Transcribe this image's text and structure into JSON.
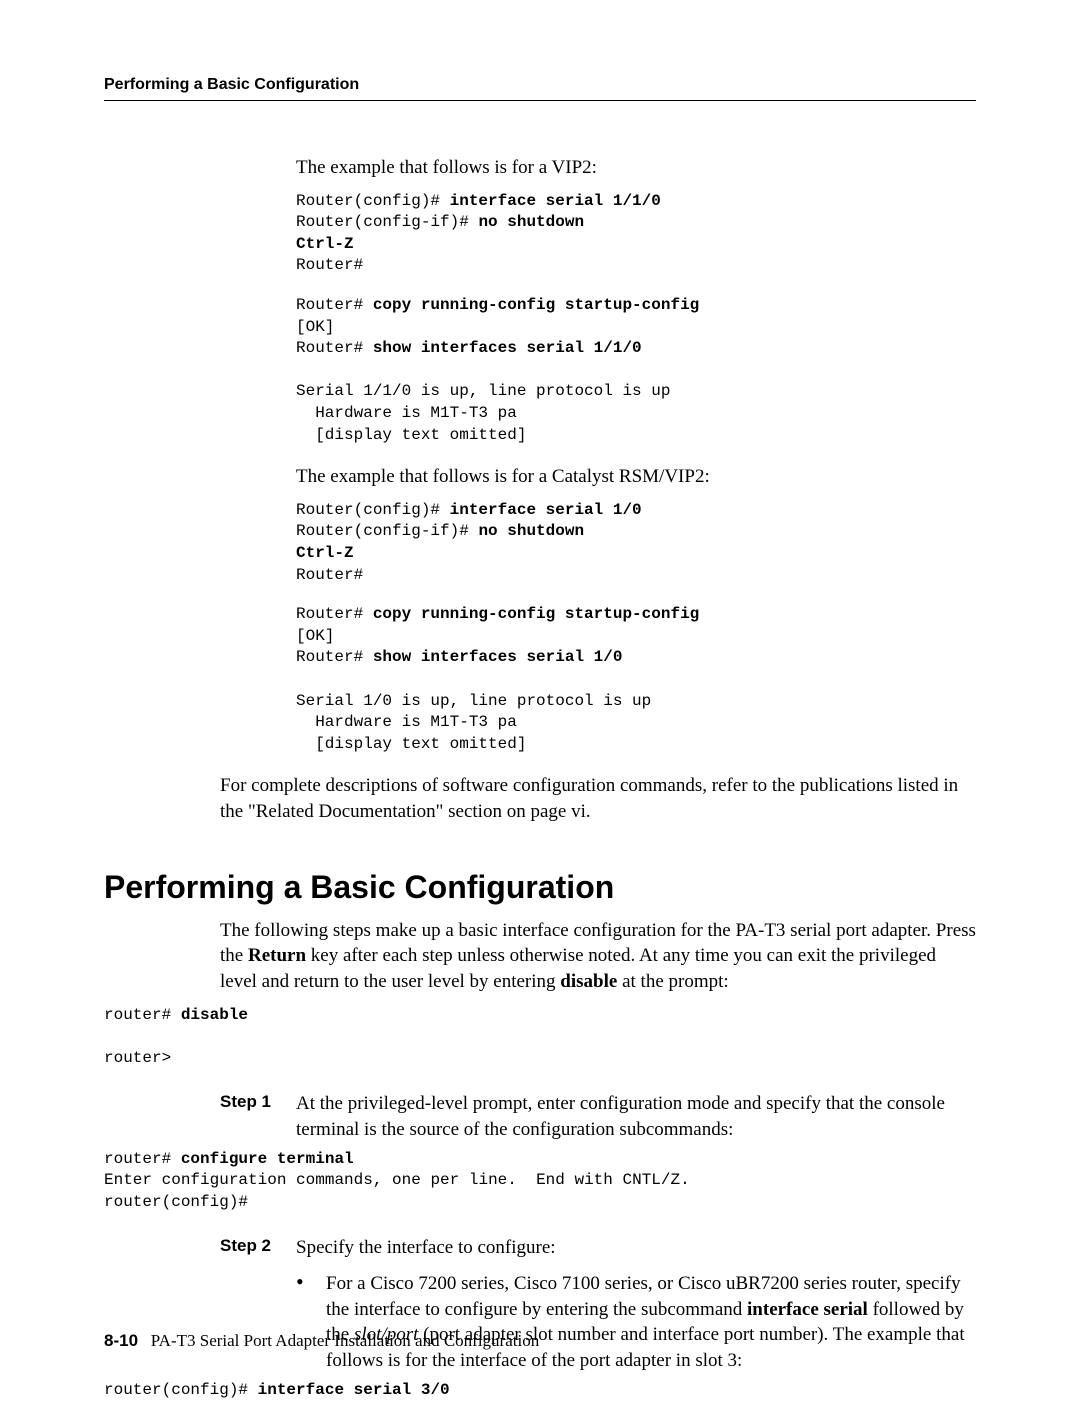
{
  "header": {
    "running": "Performing a Basic Configuration"
  },
  "example1": {
    "intro": "The example that follows is for a VIP2:",
    "l1a": "Router(config)# ",
    "l1b": "interface serial 1/1/0",
    "l2a": "Router(config-if)# ",
    "l2b": "no shutdown",
    "l3": "Ctrl-Z",
    "l4": "Router#",
    "l5a": "Router# ",
    "l5b": "copy running-config startup-config",
    "l6": "[OK]",
    "l7a": "Router# ",
    "l7b": "show interfaces serial 1/1/0",
    "l8": "Serial 1/1/0 is up, line protocol is up",
    "l9": "  Hardware is M1T-T3 pa",
    "l10": "  [display text omitted]"
  },
  "example2": {
    "intro": "The example that follows is for a Catalyst RSM/VIP2:",
    "l1a": "Router(config)# ",
    "l1b": "interface serial 1/0",
    "l2a": "Router(config-if)# ",
    "l2b": "no shutdown",
    "l3": "Ctrl-Z",
    "l4": "Router#",
    "l5a": "Router# ",
    "l5b": "copy running-config startup-config",
    "l6": "[OK]",
    "l7a": "Router# ",
    "l7b": "show interfaces serial 1/0",
    "l8": "Serial 1/0 is up, line protocol is up",
    "l9": "  Hardware is M1T-T3 pa",
    "l10": "  [display text omitted]"
  },
  "closing": "For complete descriptions of software configuration commands, refer to the publications listed in the \"Related Documentation\" section on page vi.",
  "section": {
    "title": "Performing a Basic Configuration",
    "intro_a": "The following steps make up a basic interface configuration for the PA-T3 serial port adapter. Press the ",
    "intro_b": "Return",
    "intro_c": " key after each step unless otherwise noted. At any time you can exit the privileged level and return to the user level by entering ",
    "intro_d": "disable",
    "intro_e": " at the prompt:",
    "disable_l1a": "router# ",
    "disable_l1b": "disable",
    "disable_l2": "router>"
  },
  "steps": {
    "s1": {
      "label": "Step 1",
      "text": "At the privileged-level prompt, enter configuration mode and specify that the console terminal is the source of the configuration subcommands:",
      "c1a": "router# ",
      "c1b": "configure terminal",
      "c2": "Enter configuration commands, one per line.  End with CNTL/Z.",
      "c3": "router(config)#"
    },
    "s2": {
      "label": "Step 2",
      "text": "Specify the interface to configure:",
      "b1a": "For a Cisco 7200 series, Cisco 7100 series, or Cisco uBR7200 series router, specify the interface to configure by entering the subcommand ",
      "b1b": "interface serial",
      "b1c": " followed by the ",
      "b1d": "slot/port",
      "b1e": " (port adapter slot number and interface port number). The example that follows is for the interface of the port adapter in slot 3:",
      "c1a": "router(config)# ",
      "c1b": "interface serial 3/0"
    }
  },
  "footer": {
    "page": "8-10",
    "title": "PA-T3 Serial Port Adapter Installation and Configuration"
  }
}
